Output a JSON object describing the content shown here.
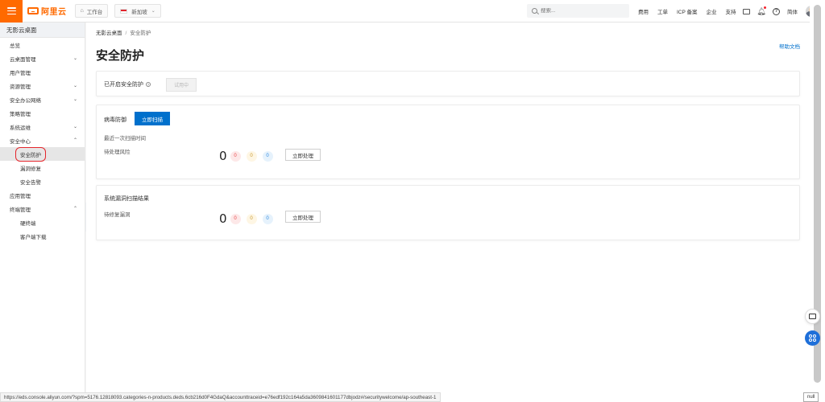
{
  "topbar": {
    "logo": "阿里云",
    "workbench": "工作台",
    "region": "新加坡",
    "search_placeholder": "搜索...",
    "links": [
      "费用",
      "工单",
      "ICP 备案",
      "企业",
      "支持"
    ],
    "lang": "简体"
  },
  "sidebar": {
    "title": "无影云桌面",
    "items": [
      {
        "label": "总览",
        "caret": "",
        "level": 1
      },
      {
        "label": "云桌面管理",
        "caret": "⌄",
        "level": 1
      },
      {
        "label": "用户管理",
        "caret": "",
        "level": 1
      },
      {
        "label": "资源管理",
        "caret": "⌄",
        "level": 1
      },
      {
        "label": "安全办公网络",
        "caret": "⌄",
        "level": 1
      },
      {
        "label": "策略管理",
        "caret": "",
        "level": 1
      },
      {
        "label": "系统运维",
        "caret": "⌄",
        "level": 1
      },
      {
        "label": "安全中心",
        "caret": "⌃",
        "level": 1
      },
      {
        "label": "安全防护",
        "caret": "",
        "level": 2,
        "active": true
      },
      {
        "label": "漏洞修复",
        "caret": "",
        "level": 2
      },
      {
        "label": "安全告警",
        "caret": "",
        "level": 2
      },
      {
        "label": "应用管理",
        "caret": "",
        "level": 1
      },
      {
        "label": "终端管理",
        "caret": "⌃",
        "level": 1
      },
      {
        "label": "硬终端",
        "caret": "",
        "level": 2
      },
      {
        "label": "客户端下载",
        "caret": "",
        "level": 2
      }
    ]
  },
  "breadcrumb": {
    "root": "无影云桌面",
    "sep": "/",
    "current": "安全防护"
  },
  "page_title": "安全防护",
  "help_link": "帮助文档",
  "protection": {
    "label": "已开启安全防护",
    "status_button": "试用中"
  },
  "virus": {
    "title": "病毒防御",
    "scan_button": "立即扫描",
    "last_scan_label": "最近一次扫描时间",
    "pending_label": "待处理风险",
    "total": "0",
    "high": "0",
    "medium": "0",
    "low": "0",
    "handle_button": "立即处理"
  },
  "vuln": {
    "title": "系统漏洞扫描结果",
    "pending_label": "待修复漏洞",
    "total": "0",
    "high": "0",
    "medium": "0",
    "low": "0",
    "handle_button": "立即处理"
  },
  "status": {
    "url": "https://eds.console.aliyun.com/?spm=5176.12818093.categories-n-products.deds.6cb216d0F4GdaQ&accounttraceid=e76edf192c164a5da3609841601177dbjodz#/securitywelcome/ap-southeast-1",
    "chip": "null"
  },
  "colors": {
    "brand": "#ff6a00",
    "primary": "#0070cc",
    "highlight": "#e5262c"
  }
}
